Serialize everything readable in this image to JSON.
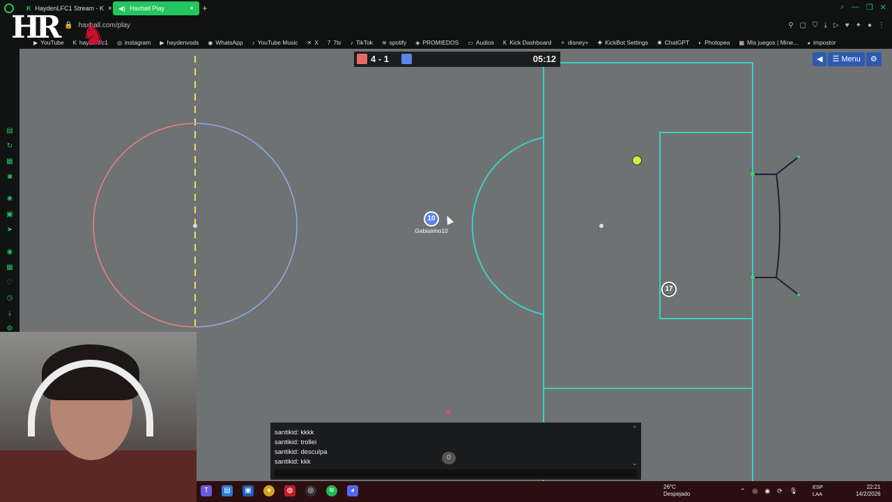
{
  "browser": {
    "tabs": [
      {
        "label": "HaydenLFC1 Stream - K",
        "active": false
      },
      {
        "label": "Haxball Play",
        "active": true
      }
    ],
    "url": "haxball.com/play",
    "new_tab": "+"
  },
  "bookmarks": [
    {
      "label": "YouTube",
      "icon": "youtube-icon"
    },
    {
      "label": "haydenlfc1",
      "icon": "kick-icon"
    },
    {
      "label": "instagram",
      "icon": "instagram-icon"
    },
    {
      "label": "haydenvods",
      "icon": "youtube-icon"
    },
    {
      "label": "WhatsApp",
      "icon": "whatsapp-icon"
    },
    {
      "label": "YouTube Music",
      "icon": "music-icon"
    },
    {
      "label": "X",
      "icon": "x-icon"
    },
    {
      "label": "7tv",
      "icon": "7tv-icon"
    },
    {
      "label": "TikTok",
      "icon": "tiktok-icon"
    },
    {
      "label": "spotify",
      "icon": "spotify-icon"
    },
    {
      "label": "PROMIEDOS",
      "icon": "promiedos-icon"
    },
    {
      "label": "Audios",
      "icon": "folder-icon"
    },
    {
      "label": "Kick Dashboard",
      "icon": "kick-icon"
    },
    {
      "label": "disney+",
      "icon": "disney-icon"
    },
    {
      "label": "KickBot Settings",
      "icon": "kickbot-icon"
    },
    {
      "label": "ChatGPT",
      "icon": "chatgpt-icon"
    },
    {
      "label": "Photopea",
      "icon": "photopea-icon"
    },
    {
      "label": "Mis juegos | Mine...",
      "icon": "minecraft-icon"
    },
    {
      "label": "impostor",
      "icon": "impostor-icon"
    }
  ],
  "game": {
    "score": "4 - 1",
    "timer": "05:12",
    "menu_label": "Menu",
    "players": [
      {
        "number": "10",
        "name": "Gabisinho10",
        "team": "blue"
      },
      {
        "number": "17",
        "name": "",
        "team": "none"
      }
    ],
    "colors": {
      "red": "#e66a6a",
      "blue": "#5b85e8",
      "field": "#6f7272",
      "lines": "#39d0c6",
      "ball": "#c8f03a"
    }
  },
  "chat": {
    "messages": [
      "santikid: kkkk",
      "santikid: trollei",
      "santikid: desculpa",
      "santikid: kkk"
    ],
    "toggle_label": "0"
  },
  "taskbar": {
    "weather_temp": "26°C",
    "weather_desc": "Despejado",
    "lang_1": "ESP",
    "lang_2": "LAA",
    "time": "22:21",
    "date": "14/2/2026"
  },
  "overlay": {
    "logo": "HR"
  }
}
